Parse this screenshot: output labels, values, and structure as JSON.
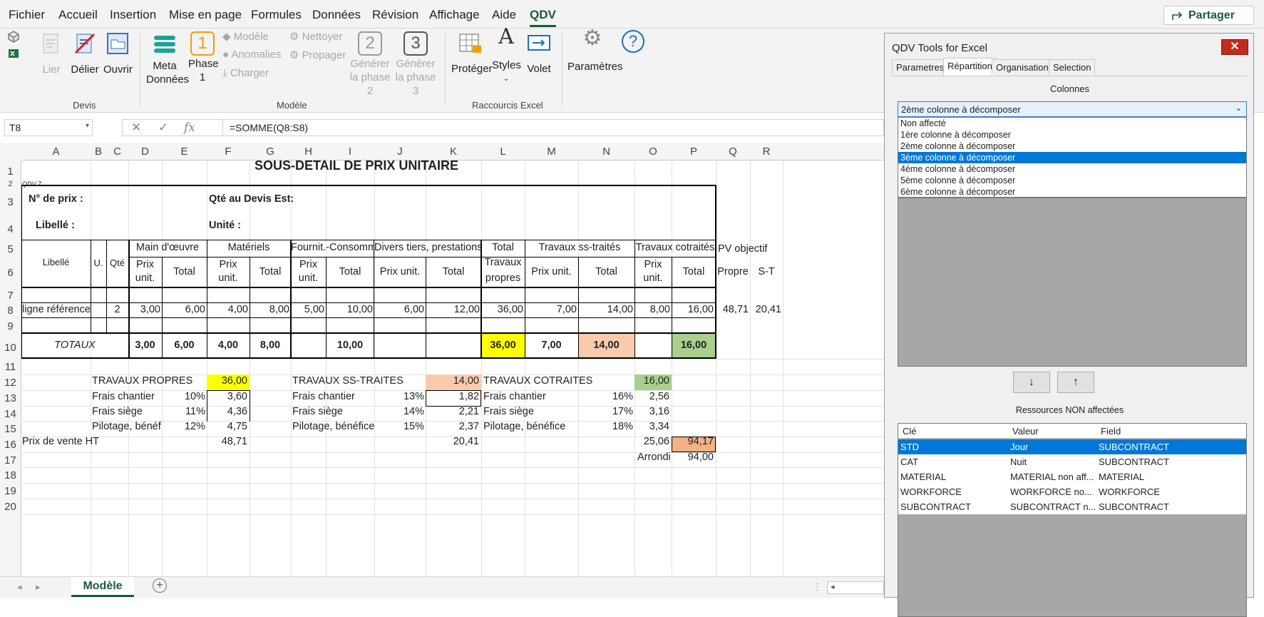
{
  "menu_tabs": [
    "Fichier",
    "Accueil",
    "Insertion",
    "Mise en page",
    "Formules",
    "Données",
    "Révision",
    "Affichage",
    "Aide",
    "QDV"
  ],
  "share_label": "Partager",
  "ribbon": {
    "devis": {
      "group": "Devis",
      "lier": "Lier",
      "delier": "Délier",
      "ouvrir": "Ouvrir"
    },
    "modele": {
      "group": "Modèle",
      "meta": "Meta",
      "donnees": "Données",
      "phase": "Phase",
      "phase_n": "1",
      "phase_num": "1",
      "modele": "Modèle",
      "anomalies": "Anomalies",
      "charger": "Charger",
      "nettoyer": "Nettoyer",
      "propager": "Propager",
      "gen": "Générer",
      "gen2": "la phase 2",
      "gen2_num": "2",
      "gen3": "la phase 3",
      "gen3_num": "3"
    },
    "raccourcis": {
      "group": "Raccourcis Excel",
      "proteger": "Protéger",
      "styles": "Styles",
      "volet": "Volet"
    },
    "parametres": "Paramètres"
  },
  "formula_bar": {
    "name_box": "T8",
    "formula": "=SOMME(Q8:S8)",
    "fx": "fx"
  },
  "columns": [
    "A",
    "B",
    "C",
    "D",
    "E",
    "F",
    "G",
    "H",
    "I",
    "J",
    "K",
    "L",
    "M",
    "N",
    "O",
    "P",
    "Q",
    "R"
  ],
  "rows": [
    "1",
    "2",
    "3",
    "4",
    "5",
    "6",
    "7",
    "8",
    "9",
    "10",
    "11",
    "12",
    "13",
    "14",
    "15",
    "16",
    "17",
    "18",
    "19",
    "20"
  ],
  "sheet": {
    "title": "SOUS-DETAIL DE PRIX UNITAIRE",
    "qdv": "QDV 7",
    "n_prix": "N° de prix :",
    "qte_devis": "Qté au Devis Est:",
    "libelle_lbl": "Libellé :",
    "unite": "Unité :",
    "h": {
      "libelle": "Libellé",
      "u": "U.",
      "qte": "Qté",
      "mo": "Main d'œuvre",
      "materiels": "Matériels",
      "fournit": "Fournit.-Consomm",
      "divers": "Divers tiers, prestations",
      "total1": "Total",
      "travaux": "Travaux",
      "propres": "propres",
      "ss": "Travaux ss-traités",
      "cot": "Travaux cotraités",
      "pv": "PV objectif",
      "prix": "Prix",
      "unit": "unit.",
      "prix_unit": "Prix unit.",
      "total": "Total",
      "propre": "Propre",
      "st": "S-T"
    },
    "row8": [
      "ligne référence",
      "2",
      "3,00",
      "6,00",
      "4,00",
      "8,00",
      "5,00",
      "10,00",
      "6,00",
      "12,00",
      "36,00",
      "7,00",
      "14,00",
      "8,00",
      "16,00",
      "48,71",
      "20,41"
    ],
    "row10": {
      "label": "TOTAUX",
      "d": "3,00",
      "e": "6,00",
      "f": "4,00",
      "g": "8,00",
      "i": "10,00",
      "l": "36,00",
      "m": "7,00",
      "n": "14,00",
      "p": "16,00"
    },
    "rec": {
      "tp": "TRAVAUX PROPRES",
      "tp_v": "36,00",
      "tst": "TRAVAUX SS-TRAITES",
      "tst_v": "14,00",
      "tc": "TRAVAUX COTRAITES",
      "tc_v": "16,00",
      "fc": "Frais chantier",
      "fs": "Frais siège",
      "pb1": "Pilotage, bénéf",
      "pb2": "Pilotage, bénéfice",
      "p10": "10%",
      "v360": "3,60",
      "p13": "13%",
      "v182": "1,82",
      "p16": "16%",
      "v256": "2,56",
      "p11": "11%",
      "v436": "4,36",
      "p14": "14%",
      "v221": "2,21",
      "p17": "17%",
      "v316": "3,16",
      "p12": "12%",
      "v475": "4,75",
      "p15": "15%",
      "v237": "2,37",
      "p18": "18%",
      "v334": "3,34",
      "pv": "Prix de vente HT",
      "pv1": "48,71",
      "pv2": "20,41",
      "pv3": "25,06",
      "pv4": "94,17",
      "arrondi": "Arrondi",
      "arr_v": "94,00"
    }
  },
  "sheet_tab": "Modèle",
  "pane": {
    "title": "QDV Tools for Excel",
    "close": "✕",
    "tabs": [
      "Parametres",
      "Répartition",
      "Organisation",
      "Selection"
    ],
    "colonnes": "Colonnes",
    "combo": "2ème colonne à décomposer",
    "options": [
      "Non affecté",
      "1ère colonne à décomposer",
      "2ème colonne à décomposer",
      "3ème colonne à décomposer",
      "4ème colonne à décomposer",
      "5ème colonne à décomposer",
      "6ème colonne à décomposer"
    ],
    "down": "↓",
    "up": "↑",
    "res_title": "Ressources NON affectées",
    "res_headers": [
      "Clé",
      "Valeur",
      "Field"
    ],
    "res_rows": [
      [
        "STD",
        "Jour",
        "SUBCONTRACT"
      ],
      [
        "CAT",
        "Nuit",
        "SUBCONTRACT"
      ],
      [
        "MATERIAL",
        "MATERIAL non aff...",
        "MATERIAL"
      ],
      [
        "WORKFORCE",
        "WORKFORCE no...",
        "WORKFORCE"
      ],
      [
        "SUBCONTRACT",
        "SUBCONTRACT n...",
        "SUBCONTRACT"
      ]
    ]
  },
  "colors": {
    "accent": "#185c37",
    "yellow": "#ffff00",
    "peach": "#f8cbad",
    "green": "#a9d08e",
    "orange": "#f4b183",
    "select": "#0078d7"
  }
}
